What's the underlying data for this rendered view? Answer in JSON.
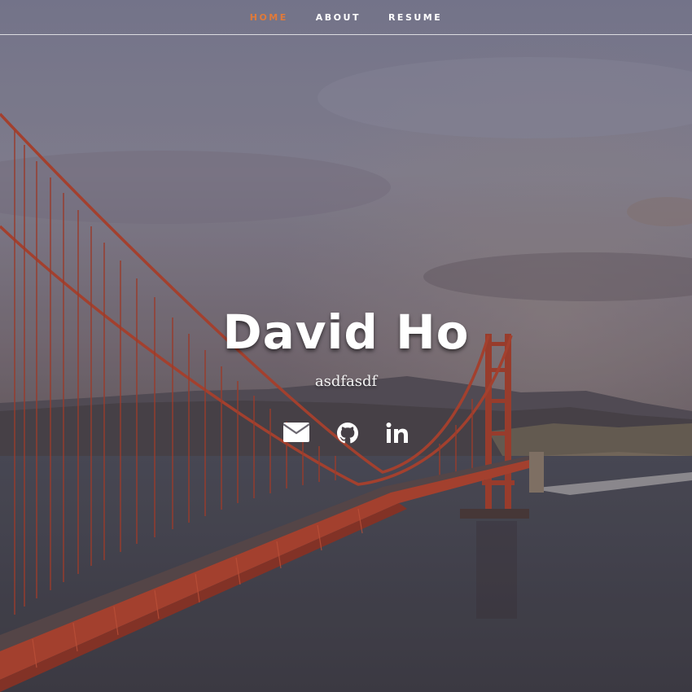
{
  "nav": {
    "items": [
      {
        "label": "HOME",
        "current": true
      },
      {
        "label": "ABOUT",
        "current": false
      },
      {
        "label": "RESUME",
        "current": false
      }
    ]
  },
  "banner": {
    "name": "David Ho",
    "subtitle": "asdfasdf"
  },
  "social": [
    {
      "icon": "envelope-icon"
    },
    {
      "icon": "github-icon"
    },
    {
      "icon": "linkedin-icon"
    }
  ],
  "colors": {
    "accent": "#e07a3a",
    "bridge": "#b4452e",
    "text": "#ffffff"
  }
}
